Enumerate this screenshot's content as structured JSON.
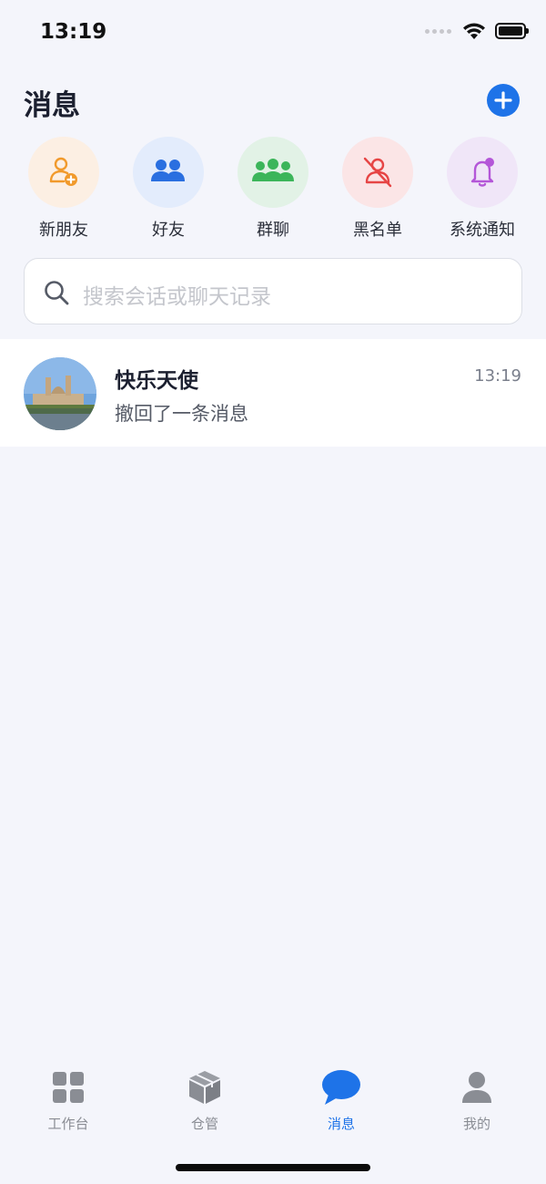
{
  "status_bar": {
    "time": "13:19"
  },
  "header": {
    "title": "消息"
  },
  "shortcuts": [
    {
      "label": "新朋友",
      "icon": "add-person-icon",
      "bg": "#fcefe3",
      "color": "#f19a2c"
    },
    {
      "label": "好友",
      "icon": "friends-icon",
      "bg": "#e3ecfc",
      "color": "#2a6fe0"
    },
    {
      "label": "群聊",
      "icon": "group-icon",
      "bg": "#e2f2e6",
      "color": "#3cb55a"
    },
    {
      "label": "黑名单",
      "icon": "blocked-person-icon",
      "bg": "#fbe5e6",
      "color": "#e64545"
    },
    {
      "label": "系统通知",
      "icon": "bell-icon",
      "bg": "#f0e6f8",
      "color": "#b457d8"
    }
  ],
  "search": {
    "placeholder": "搜索会话或聊天记录"
  },
  "conversations": [
    {
      "name": "快乐天使",
      "preview": "撤回了一条消息",
      "time": "13:19"
    }
  ],
  "tabs": [
    {
      "label": "工作台",
      "icon": "grid-icon"
    },
    {
      "label": "仓管",
      "icon": "box-icon"
    },
    {
      "label": "消息",
      "icon": "chat-bubble-icon"
    },
    {
      "label": "我的",
      "icon": "person-icon"
    }
  ],
  "colors": {
    "accent": "#1e73e8",
    "inactive": "#8a8d94"
  }
}
